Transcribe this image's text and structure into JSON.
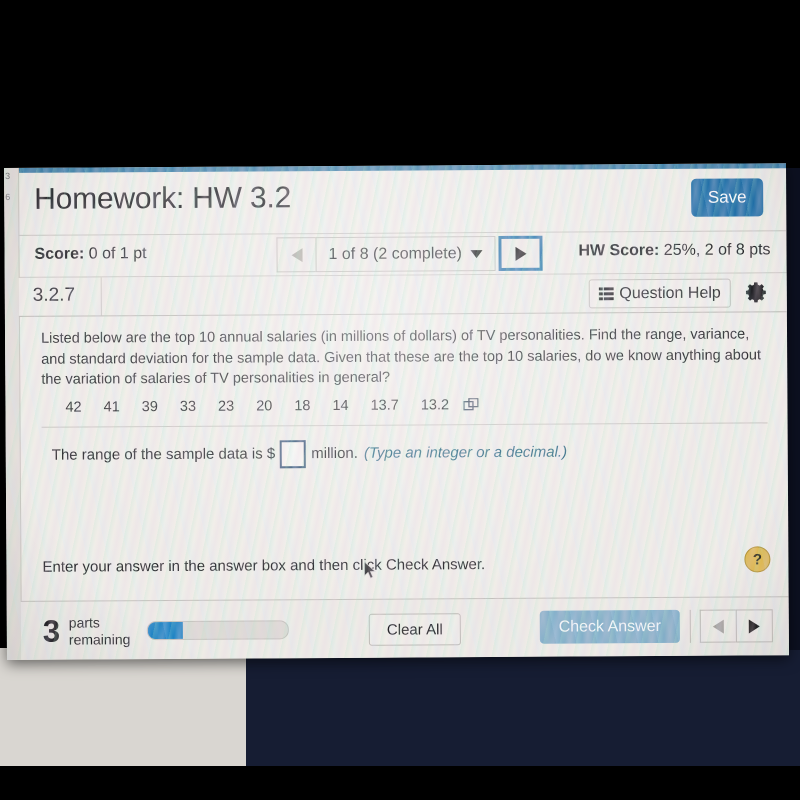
{
  "photo": {
    "note": "screenshot photographed off a monitor; black bars top and bottom"
  },
  "sidebar_fragment": {
    "numbers": [
      "3",
      "6"
    ]
  },
  "header": {
    "title": "Homework: HW 3.2",
    "save_label": "Save"
  },
  "score_row": {
    "score_label": "Score:",
    "score_value": "0 of 1 pt",
    "nav_label": "1 of 8 (2 complete)",
    "prev_icon": "triangle-left-icon",
    "next_icon": "triangle-right-icon",
    "dropdown_icon": "triangle-down-icon",
    "hw_score_label": "HW Score:",
    "hw_score_value": "25%, 2 of 8 pts"
  },
  "question_bar": {
    "question_id": "3.2.7",
    "help_label": "Question Help",
    "help_icon": "list-icon",
    "settings_icon": "gear-icon"
  },
  "question": {
    "prompt": "Listed below are the top 10 annual salaries (in millions of dollars) of TV personalities. Find the range, variance, and standard deviation for the sample data. Given that these are the top 10 salaries, do we know anything about the variation of salaries of TV personalities in general?",
    "data_values": [
      "42",
      "41",
      "39",
      "33",
      "23",
      "20",
      "18",
      "14",
      "13.7",
      "13.2"
    ],
    "popout_icon": "popout-window-icon",
    "answer_prefix": "The range of the sample data is $",
    "answer_value": "",
    "answer_suffix": "million.",
    "answer_hint": "(Type an integer or a decimal.)",
    "instruction": "Enter your answer in the answer box and then click Check Answer.",
    "help_circle_label": "?"
  },
  "footer": {
    "parts_count": "3",
    "parts_label_line1": "parts",
    "parts_label_line2": "remaining",
    "progress_percent": 25,
    "clear_label": "Clear All",
    "check_label": "Check Answer",
    "prev_icon": "triangle-left-icon",
    "next_icon": "triangle-right-icon"
  },
  "colors": {
    "save_blue": "#1f6fa8",
    "progress_blue": "#1b82c4",
    "check_blue_disabled": "#83afc9",
    "focus_outline": "#1f6fa8",
    "hint_teal": "#1f5f7a",
    "help_gold": "#e0b94e",
    "panel_bg": "#efeee9"
  }
}
